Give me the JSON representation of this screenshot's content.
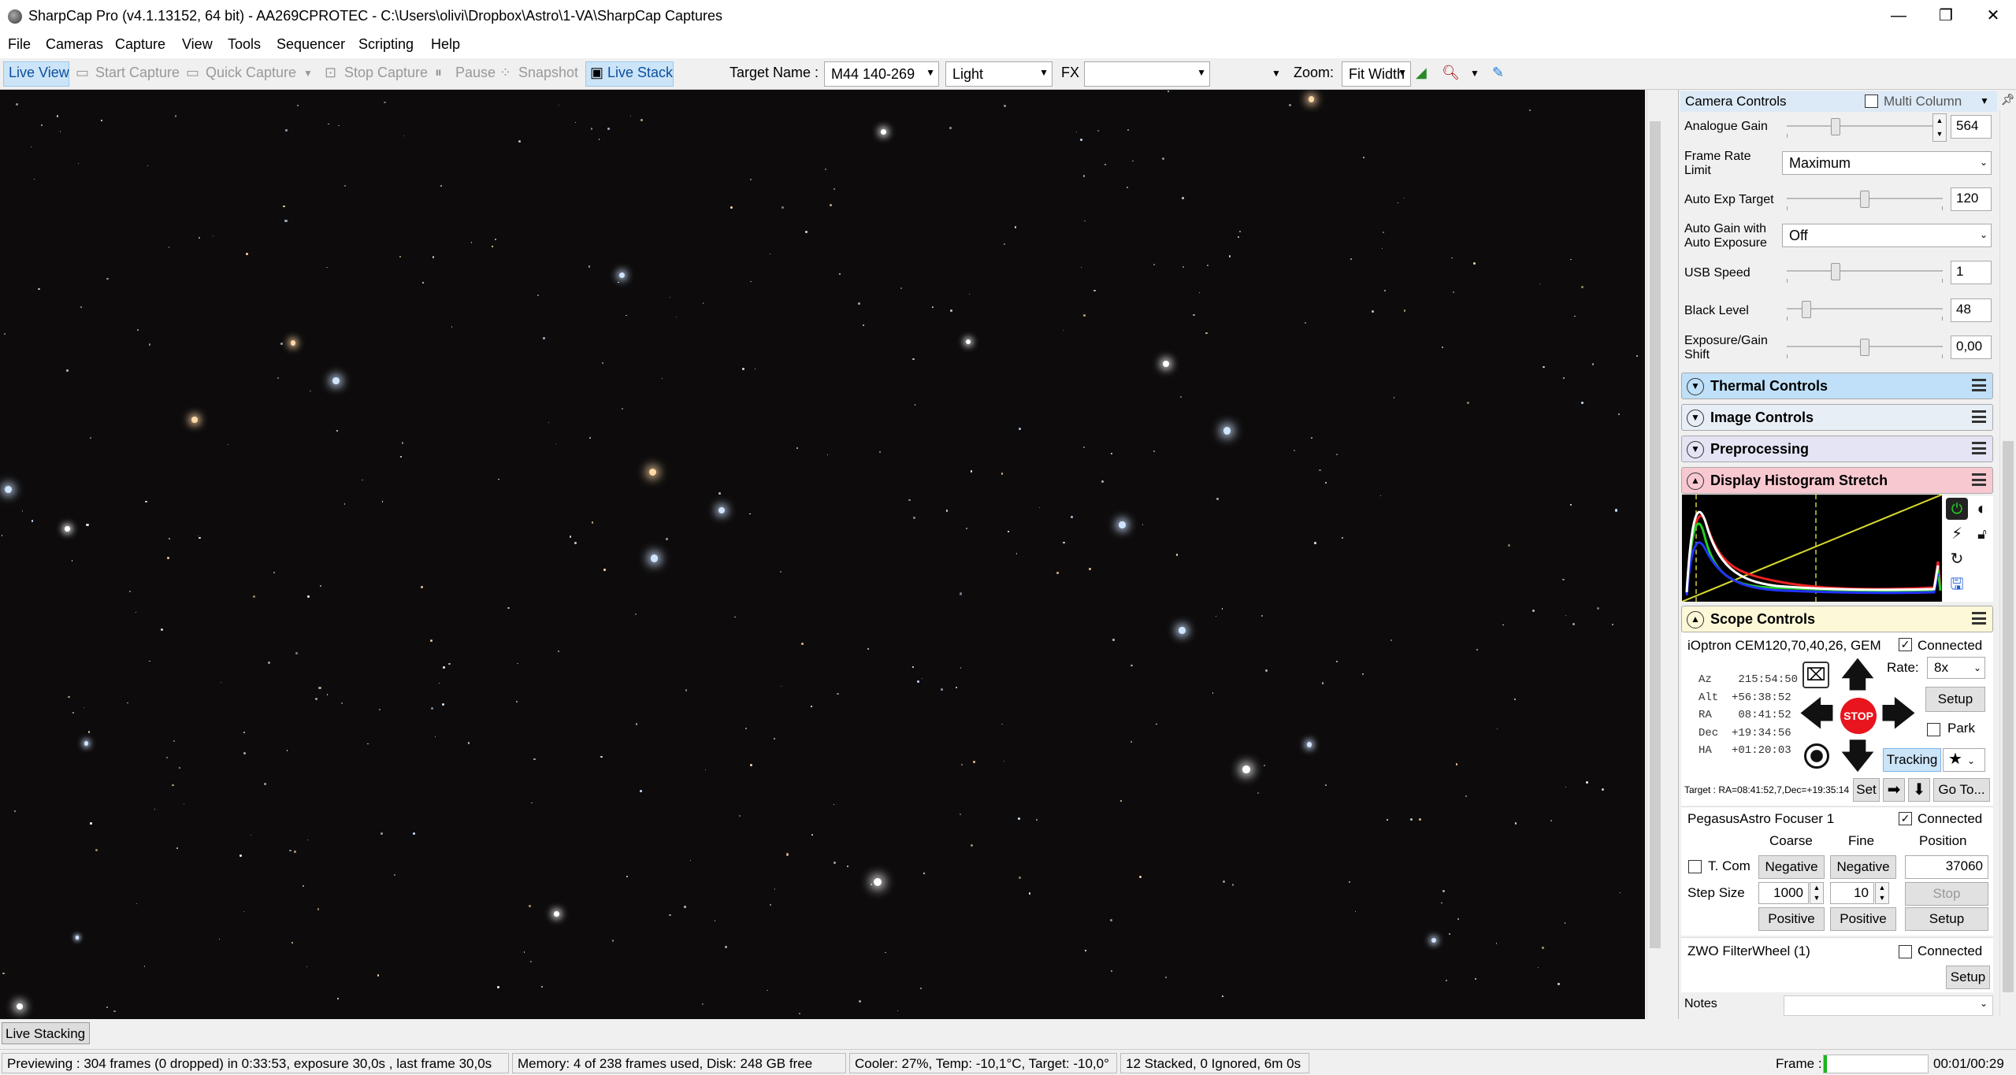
{
  "window": {
    "title": "SharpCap Pro (v4.1.13152, 64 bit) - AA269CPROTEC - C:\\Users\\olivi\\Dropbox\\Astro\\1-VA\\SharpCap Captures",
    "minimize": "—",
    "maximize": "❐",
    "close": "✕"
  },
  "menu": [
    "File",
    "Cameras",
    "Capture",
    "View",
    "Tools",
    "Sequencer",
    "Scripting",
    "Help"
  ],
  "toolbar": {
    "live_view": "Live View",
    "start_capture": "Start Capture",
    "quick_capture": "Quick Capture",
    "stop_capture": "Stop Capture",
    "pause": "Pause",
    "snapshot": "Snapshot",
    "live_stack": "Live Stack",
    "target_name_label": "Target Name :",
    "target_name_value": "M44 140-269",
    "frame_type": "Light",
    "fx_label": "FX",
    "fx_value": "",
    "zoom_label": "Zoom:",
    "zoom_value": "Fit Width"
  },
  "camera_controls": {
    "title": "Camera Controls",
    "multi_column": "Multi Column",
    "analogue_gain_label": "Analogue Gain",
    "analogue_gain_value": "564",
    "frame_rate_label": "Frame Rate Limit",
    "frame_rate_value": "Maximum",
    "auto_exp_label": "Auto Exp Target",
    "auto_exp_value": "120",
    "auto_gain_label": "Auto Gain with Auto Exposure",
    "auto_gain_value": "Off",
    "usb_speed_label": "USB Speed",
    "usb_speed_value": "1",
    "black_level_label": "Black Level",
    "black_level_value": "48",
    "exp_gain_shift_label": "Exposure/Gain Shift",
    "exp_gain_shift_value": "0,00",
    "analogue_gain_level": 0.3,
    "auto_exp_level": 0.5,
    "usb_speed_level": 0.3,
    "black_level_level": 0.1,
    "exp_gain_shift_level": 0.5
  },
  "sections": {
    "thermal": "Thermal Controls",
    "image": "Image Controls",
    "preprocessing": "Preprocessing",
    "histogram": "Display Histogram Stretch",
    "scope": "Scope Controls"
  },
  "scope": {
    "mount_name": "iOptron CEM120,70,40,26, GEM",
    "connected": "Connected",
    "az": "Az    215:54:50",
    "alt": "Alt  +56:38:52",
    "ra": "RA    08:41:52",
    "dec": "Dec  +19:34:56",
    "ha": "HA   +01:20:03",
    "rate_label": "Rate:",
    "rate_value": "8x",
    "setup": "Setup",
    "stop": "STOP",
    "park": "Park",
    "tracking": "Tracking",
    "target": "Target : RA=08:41:52,7,Dec=+19:35:14",
    "set": "Set",
    "goto": "Go To..."
  },
  "focuser": {
    "name": "PegasusAstro Focuser 1",
    "connected": "Connected",
    "coarse": "Coarse",
    "fine": "Fine",
    "position": "Position",
    "tcom": "T. Com",
    "negative": "Negative",
    "position_value": "37060",
    "step_size_label": "Step Size",
    "coarse_step": "1000",
    "fine_step": "10",
    "stop": "Stop",
    "positive": "Positive",
    "setup": "Setup"
  },
  "filterwheel": {
    "name": "ZWO FilterWheel (1)",
    "connected": "Connected",
    "setup": "Setup"
  },
  "notes_label": "Notes",
  "live_stacking_tab": "Live Stacking",
  "status": {
    "previewing": "Previewing : 304 frames (0 dropped) in 0:33:53, exposure 30,0s , last frame 30,0s",
    "memory": "Memory: 4 of 238 frames used, Disk: 248 GB free",
    "cooler": "Cooler: 27%, Temp: -10,1°C, Target: -10,0°",
    "stacked": "12 Stacked, 0 Ignored, 6m 0s",
    "frame_label": "Frame :",
    "time": "00:01/00:29"
  },
  "colors": {
    "accent": "#0b4f9e",
    "thermal_bg": "#bfe0f8",
    "image_bg": "#e8eef6",
    "preproc_bg": "#e4e4f4",
    "histogram_bg": "#f8c8d0",
    "scope_bg": "#fdf8d8",
    "stop_red": "#e8141e"
  }
}
